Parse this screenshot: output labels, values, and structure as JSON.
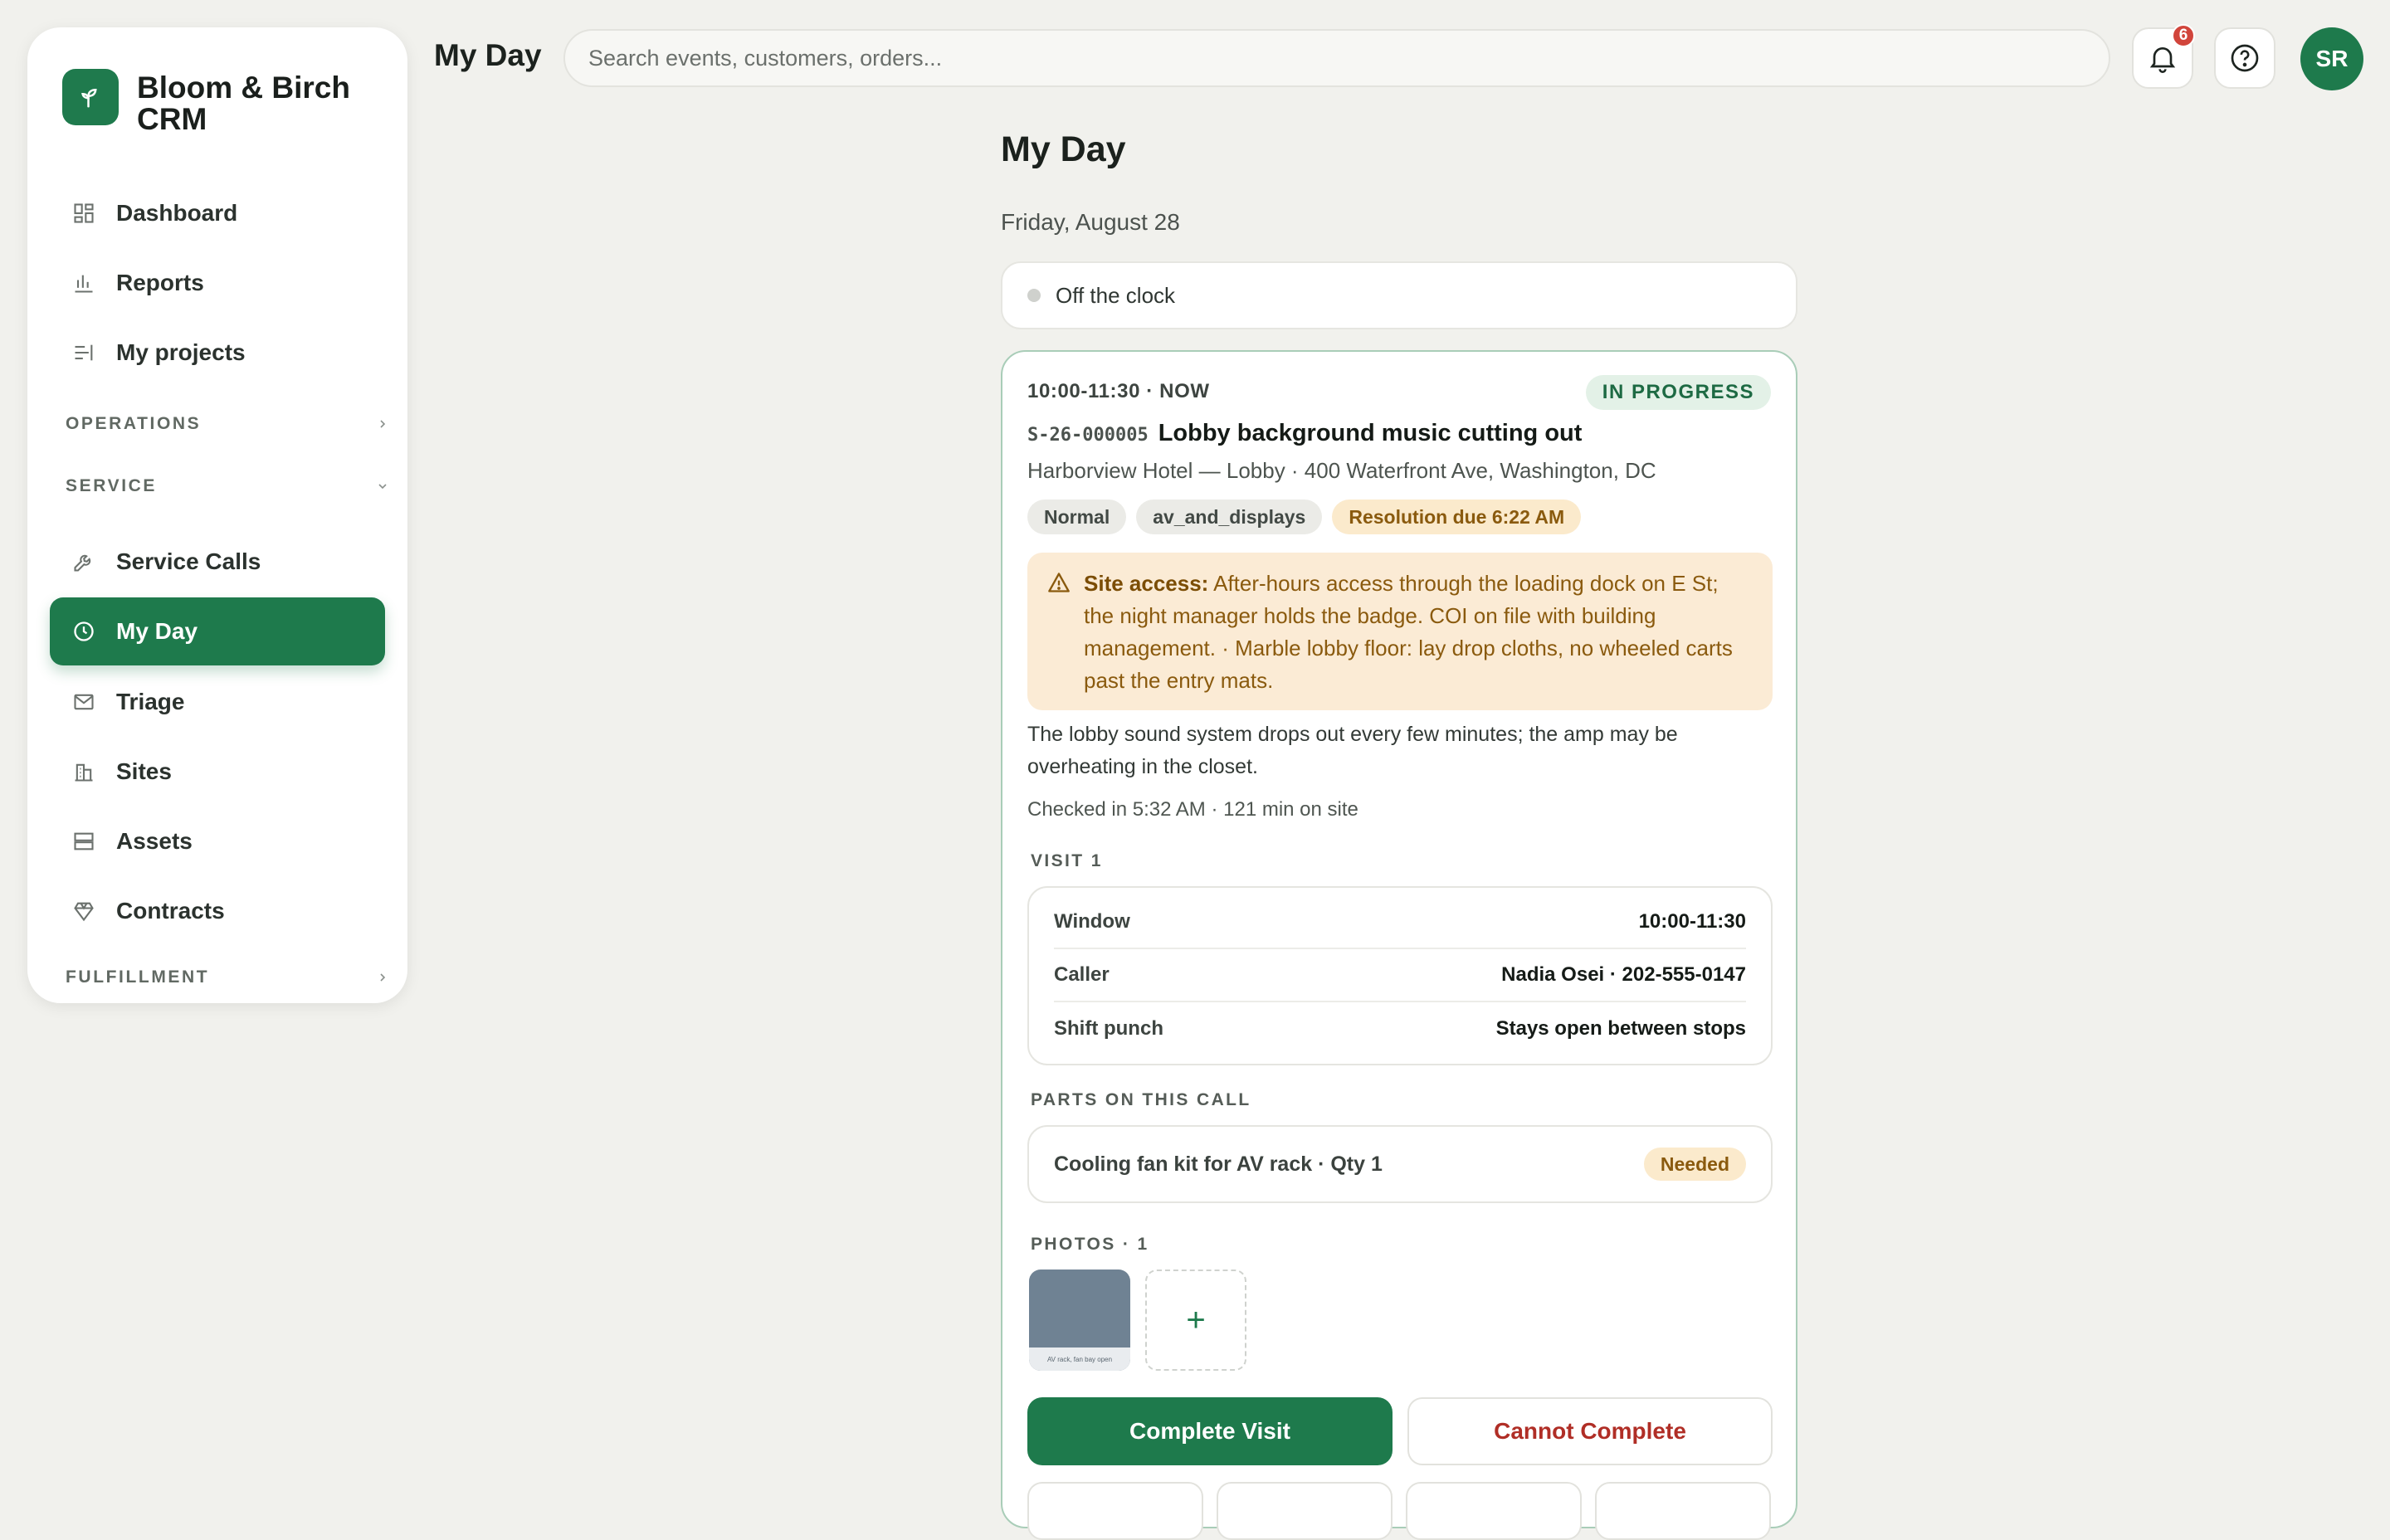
{
  "app": {
    "brand_name": "Bloom & Birch CRM",
    "page_title": "My Day",
    "colors": {
      "accent": "#1e7a4c",
      "warning": "#8a5a0e",
      "danger": "#b02e26"
    }
  },
  "topbar": {
    "title": "My Day",
    "search_placeholder": "Search events, customers, orders...",
    "notification_count": "6",
    "avatar_initials": "SR"
  },
  "sidebar": {
    "items": [
      {
        "label": "Dashboard",
        "icon": "dashboard-icon"
      },
      {
        "label": "Reports",
        "icon": "bar-chart-icon"
      },
      {
        "label": "My projects",
        "icon": "list-icon"
      }
    ],
    "sections": {
      "operations": "OPERATIONS",
      "service": "SERVICE",
      "fulfillment": "FULFILLMENT"
    },
    "service_items": [
      {
        "label": "Service Calls",
        "icon": "wrench-icon"
      },
      {
        "label": "My Day",
        "icon": "clock-icon",
        "active": true
      },
      {
        "label": "Triage",
        "icon": "mail-icon"
      },
      {
        "label": "Sites",
        "icon": "building-icon"
      },
      {
        "label": "Assets",
        "icon": "server-icon"
      },
      {
        "label": "Contracts",
        "icon": "gem-icon"
      }
    ]
  },
  "main": {
    "heading": "My Day",
    "date": "Friday, August 28",
    "clock_status": "Off the clock",
    "call": {
      "time": "10:00-11:30 · NOW",
      "status": "IN PROGRESS",
      "id": "S-26-000005",
      "title": "Lobby background music cutting out",
      "address": "Harborview Hotel — Lobby · 400 Waterfront Ave, Washington, DC",
      "tags": [
        "Normal",
        "av_and_displays",
        "Resolution due 6:22 AM"
      ],
      "site_access_label": "Site access:",
      "site_access_text": " After-hours access through the loading dock on E St; the night manager holds the badge. COI on file with building management. · Marble lobby floor: lay drop cloths, no wheeled carts past the entry mats.",
      "description": "The lobby sound system drops out every few minutes; the amp may be overheating in the closet.",
      "checked_in": "Checked in 5:32 AM · 121 min on site",
      "visit_label": "VISIT 1",
      "visit_rows": [
        {
          "key": "Window",
          "value": "10:00-11:30"
        },
        {
          "key": "Caller",
          "value": "Nadia Osei · 202-555-0147"
        },
        {
          "key": "Shift punch",
          "value": "Stays open between stops"
        }
      ],
      "parts_label": "PARTS ON THIS CALL",
      "parts": [
        {
          "name": "Cooling fan kit for AV rack · Qty 1",
          "status": "Needed"
        }
      ],
      "photos_label": "PHOTOS · 1",
      "photo_caption": "AV rack, fan bay open",
      "add_photo": "+",
      "complete_button": "Complete Visit",
      "cannot_button": "Cannot Complete"
    }
  }
}
